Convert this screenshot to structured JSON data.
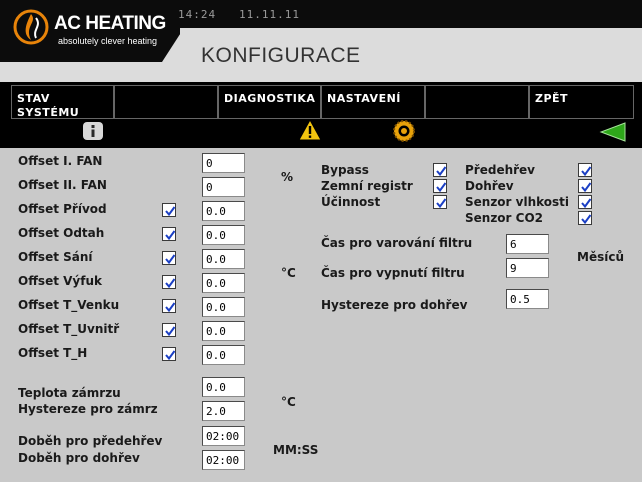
{
  "header": {
    "logo_title": "AC HEATING",
    "logo_subtitle": "absolutely clever heating",
    "time": "14:24",
    "date": "11.11.11",
    "page_title": "KONFIGURACE"
  },
  "nav": {
    "buttons": [
      {
        "label": "STAV SYSTÉMU"
      },
      {
        "label": ""
      },
      {
        "label": "DIAGNOSTIKA"
      },
      {
        "label": "NASTAVENÍ"
      },
      {
        "label": ""
      },
      {
        "label": "ZPĚT"
      }
    ],
    "icons": [
      "info-icon",
      "warning-icon",
      "gear-icon",
      "back-arrow-icon"
    ]
  },
  "offsets": {
    "rows": [
      {
        "label": "Offset I. FAN",
        "value": "0",
        "checkbox": false
      },
      {
        "label": "Offset II. FAN",
        "value": "0",
        "checkbox": false
      },
      {
        "label": "Offset Přívod",
        "value": "0.0",
        "checkbox": true,
        "checked": true
      },
      {
        "label": "Offset Odtah",
        "value": "0.0",
        "checkbox": true,
        "checked": true
      },
      {
        "label": "Offset Sání",
        "value": "0.0",
        "checkbox": true,
        "checked": true
      },
      {
        "label": "Offset Výfuk",
        "value": "0.0",
        "checkbox": true,
        "checked": true
      },
      {
        "label": "Offset T_Venku",
        "value": "0.0",
        "checkbox": true,
        "checked": true
      },
      {
        "label": "Offset T_Uvnitř",
        "value": "0.0",
        "checkbox": true,
        "checked": true
      },
      {
        "label": "Offset T_H",
        "value": "0.0",
        "checkbox": true,
        "checked": true
      }
    ],
    "unit_percent": "%",
    "unit_celsius": "°C"
  },
  "freeze": {
    "temp_label": "Teplota zámrzu",
    "temp_value": "0.0",
    "hyst_label": "Hystereze pro zámrz",
    "hyst_value": "2.0",
    "unit": "°C"
  },
  "runon": {
    "preheat_label": "Doběh pro předehřev",
    "preheat_value": "02:00",
    "afterheat_label": "Doběh pro dohřev",
    "afterheat_value": "02:00",
    "unit": "MM:SS"
  },
  "features_left": [
    {
      "label": "Bypass",
      "checked": true
    },
    {
      "label": "Zemní registr",
      "checked": true
    },
    {
      "label": "Účinnost",
      "checked": true
    }
  ],
  "features_right": [
    {
      "label": "Předehřev",
      "checked": true
    },
    {
      "label": "Dohřev",
      "checked": true
    },
    {
      "label": "Senzor vlhkosti",
      "checked": true
    },
    {
      "label": "Senzor CO2",
      "checked": true
    }
  ],
  "filter": {
    "warn_label": "Čas pro varování filtru",
    "warn_value": "6",
    "off_label": "Čas pro vypnutí filtru",
    "off_value": "9",
    "unit": "Měsíců",
    "afterheat_hyst_label": "Hystereze pro dohřev",
    "afterheat_hyst_value": "0.5"
  },
  "colors": {
    "accent_orange": "#e8840a",
    "checkmark_blue": "#1b3fc4",
    "back_green": "#2ea61a",
    "warning_yellow": "#f2c40f"
  }
}
